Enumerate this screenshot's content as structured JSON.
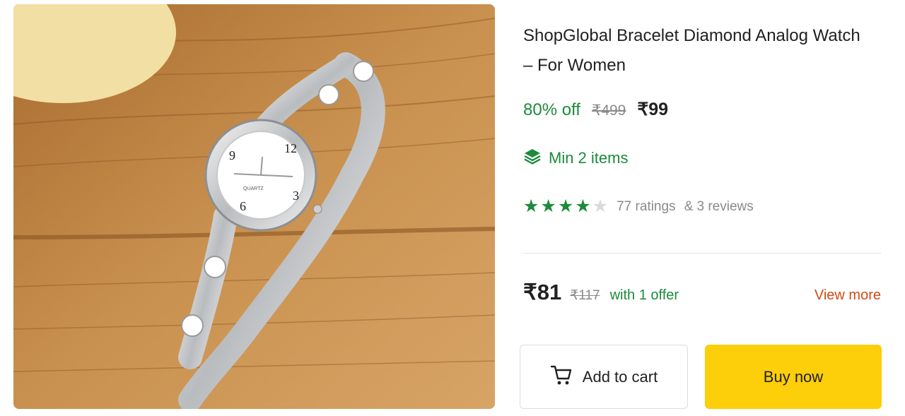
{
  "product": {
    "title_line1": "ShopGlobal Bracelet Diamond Analog Watch",
    "title_line2": "– For Women",
    "image_icon": "product-photo-watch",
    "dial_label": "QUARTZ"
  },
  "pricing": {
    "discount": "80% off",
    "mrp": "₹499",
    "price": "₹99"
  },
  "min_order": {
    "icon": "layers-icon",
    "label": "Min 2 items"
  },
  "rating": {
    "stars": 4.5,
    "max_stars": 5,
    "ratings_text": "77 ratings",
    "reviews_text": "& 3 reviews"
  },
  "offer": {
    "price": "₹81",
    "mrp": "₹117",
    "text": "with 1 offer",
    "view_more": "View more"
  },
  "actions": {
    "add_to_cart": "Add to cart",
    "buy_now": "Buy now",
    "cart_icon": "cart-icon"
  },
  "colors": {
    "green": "#1c8b3a",
    "orange": "#d14a13",
    "buy_yellow": "#fdce0a"
  }
}
